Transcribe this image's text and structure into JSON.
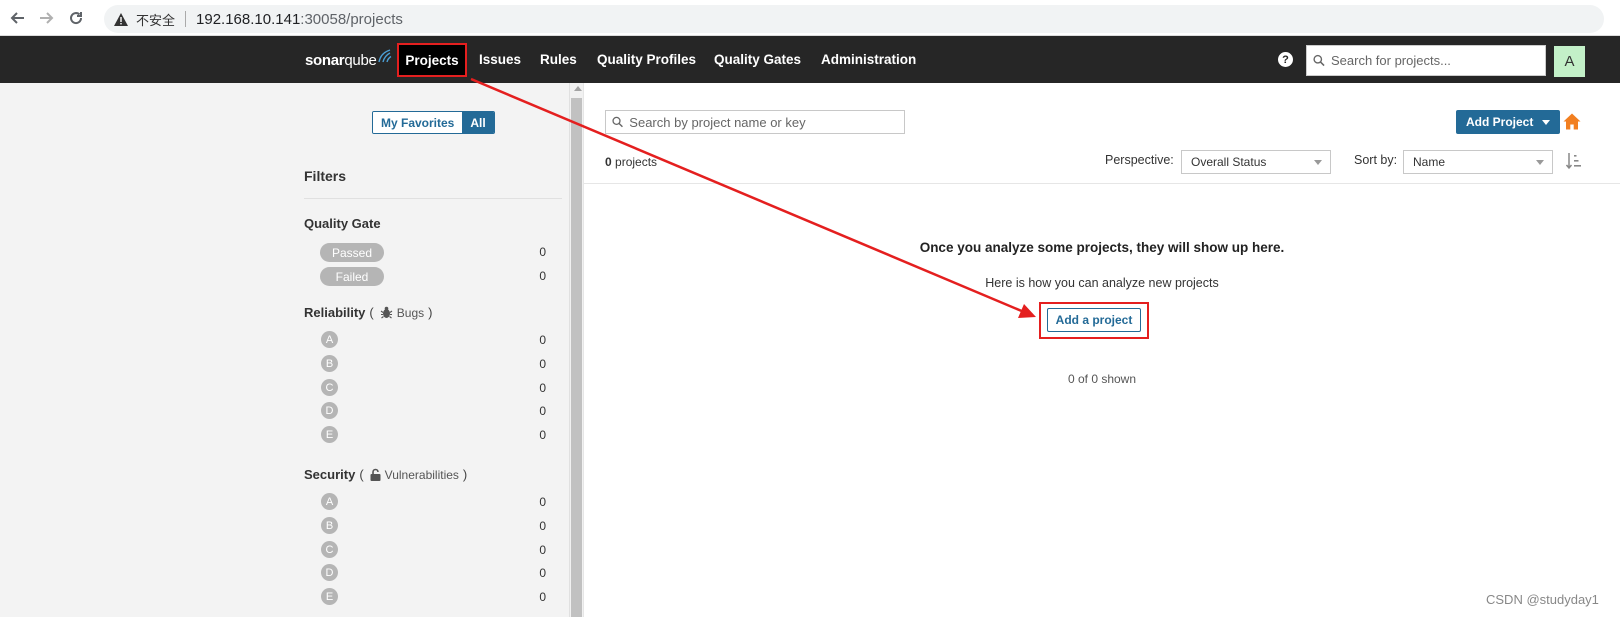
{
  "browser": {
    "insecure_label": "不安全",
    "url_host": "192.168.10.141",
    "url_rest": ":30058/projects"
  },
  "topnav": {
    "logo_bold": "sonar",
    "logo_thin": "qube",
    "items": [
      {
        "label": "Projects"
      },
      {
        "label": "Issues"
      },
      {
        "label": "Rules"
      },
      {
        "label": "Quality Profiles"
      },
      {
        "label": "Quality Gates"
      },
      {
        "label": "Administration"
      }
    ],
    "help_label": "?",
    "search_placeholder": "Search for projects...",
    "avatar_letter": "A"
  },
  "sidebar": {
    "favorites_toggle": {
      "my_favorites": "My Favorites",
      "all": "All",
      "selected": "All"
    },
    "filters_title": "Filters",
    "quality_gate": {
      "title": "Quality Gate",
      "options": [
        {
          "label": "Passed",
          "count": "0"
        },
        {
          "label": "Failed",
          "count": "0"
        }
      ]
    },
    "reliability": {
      "title": "Reliability",
      "open_paren": "(",
      "sub_label": "Bugs",
      "close_paren": ")",
      "icon": "bug-icon",
      "ratings": [
        {
          "label": "A",
          "count": "0"
        },
        {
          "label": "B",
          "count": "0"
        },
        {
          "label": "C",
          "count": "0"
        },
        {
          "label": "D",
          "count": "0"
        },
        {
          "label": "E",
          "count": "0"
        }
      ]
    },
    "security": {
      "title": "Security",
      "open_paren": "(",
      "sub_label": "Vulnerabilities",
      "close_paren": ")",
      "icon": "lock-icon",
      "ratings": [
        {
          "label": "A",
          "count": "0"
        },
        {
          "label": "B",
          "count": "0"
        },
        {
          "label": "C",
          "count": "0"
        },
        {
          "label": "D",
          "count": "0"
        },
        {
          "label": "E",
          "count": "0"
        }
      ]
    }
  },
  "main": {
    "search_placeholder": "Search by project name or key",
    "add_project_label": "Add Project",
    "projects_count": "0",
    "projects_word": " projects",
    "perspective_label": "Perspective:",
    "perspective_value": "Overall Status",
    "sort_label": "Sort by:",
    "sort_value": "Name",
    "empty_title": "Once you analyze some projects, they will show up here.",
    "empty_sub": "Here is how you can analyze new projects",
    "add_a_project_label": "Add a project",
    "shown_count": "0 of 0 shown"
  },
  "watermark": "CSDN @studyday1",
  "colors": {
    "nav_bg": "#262626",
    "accent": "#236a97",
    "highlight_red": "#e41f1f",
    "home_orange": "#f27f20",
    "pill_grey": "#b5b5b5"
  }
}
